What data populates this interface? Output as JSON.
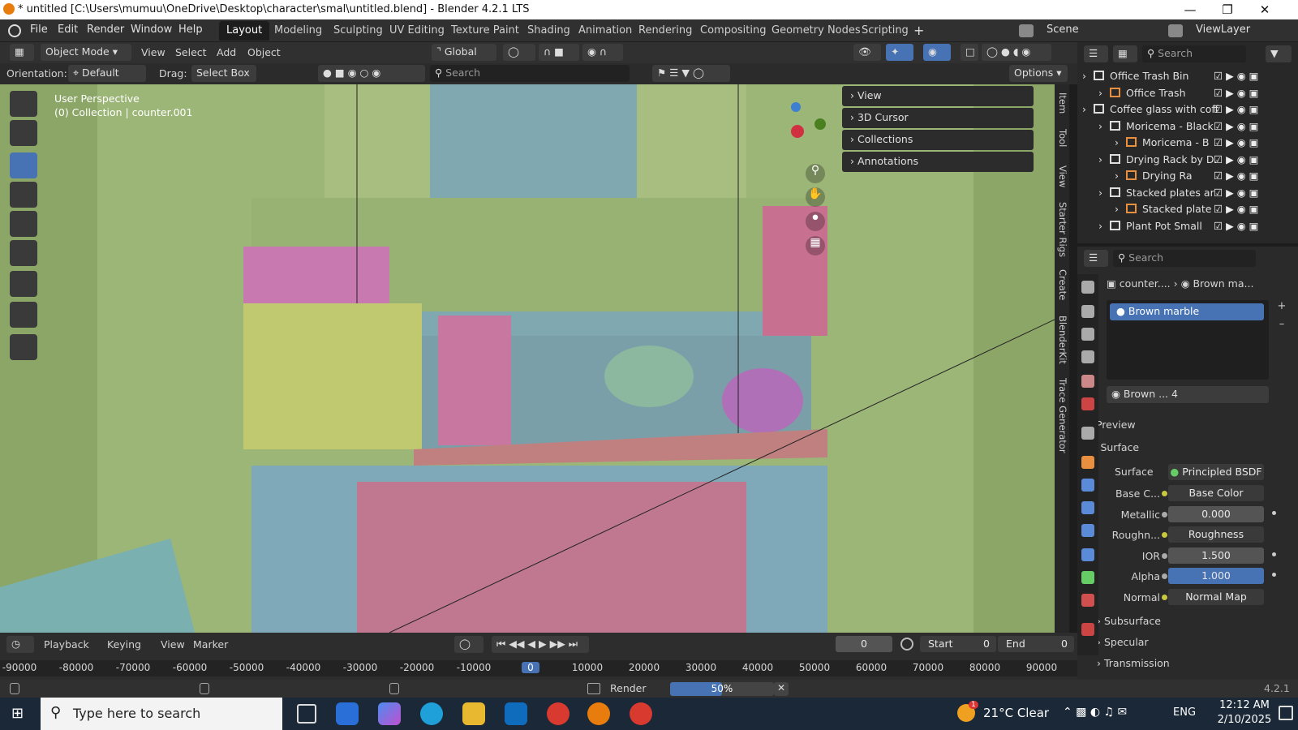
{
  "window": {
    "title": "* untitled [C:\\Users\\mumuu\\OneDrive\\Desktop\\character\\smal\\untitled.blend] - Blender 4.2.1 LTS"
  },
  "menus": [
    "File",
    "Edit",
    "Render",
    "Window",
    "Help"
  ],
  "workspaces": [
    "Layout",
    "Modeling",
    "Sculpting",
    "UV Editing",
    "Texture Paint",
    "Shading",
    "Animation",
    "Rendering",
    "Compositing",
    "Geometry Nodes",
    "Scripting"
  ],
  "scene": "Scene",
  "viewlayer": "ViewLayer",
  "header": {
    "mode": "Object Mode",
    "view": "View",
    "select": "Select",
    "add": "Add",
    "object": "Object",
    "transform": "Global"
  },
  "header3": {
    "orientation_label": "Orientation:",
    "orientation": "Default",
    "drag_label": "Drag:",
    "drag": "Select Box",
    "search": "Search",
    "options": "Options"
  },
  "viewport": {
    "line1": "User Perspective",
    "line2": "(0) Collection | counter.001",
    "bg": "#8ca668"
  },
  "npanel": [
    "View",
    "3D Cursor",
    "Collections",
    "Annotations"
  ],
  "sidetabs": [
    "Item",
    "Tool",
    "View",
    "Starter Rigs",
    "Create",
    "BlenderKit",
    "Trace Generator"
  ],
  "outliner": {
    "search": "Search",
    "rows": [
      {
        "name": "Office Trash Bin",
        "indent": 0,
        "type": "collection"
      },
      {
        "name": "Office Trash",
        "indent": 1,
        "type": "object"
      },
      {
        "name": "Coffee glass with coff",
        "indent": 0,
        "type": "collection"
      },
      {
        "name": "Moricema - Black",
        "indent": 1,
        "type": "collection"
      },
      {
        "name": "Moricema - B",
        "indent": 2,
        "type": "object"
      },
      {
        "name": "Drying Rack by D.",
        "indent": 1,
        "type": "collection"
      },
      {
        "name": "Drying Ra",
        "indent": 2,
        "type": "object"
      },
      {
        "name": "Stacked plates ar",
        "indent": 1,
        "type": "collection"
      },
      {
        "name": "Stacked plate",
        "indent": 2,
        "type": "object"
      },
      {
        "name": "Plant Pot Small",
        "indent": 1,
        "type": "collection"
      }
    ]
  },
  "properties": {
    "search": "Search",
    "breadcrumb_obj": "counter....",
    "breadcrumb_mat": "Brown ma...",
    "material_slot": "Brown marble",
    "material_name": "Brown ...",
    "users": "4",
    "sections": {
      "preview": "Preview",
      "surface": "Surface"
    },
    "surface_label": "Surface",
    "surface_value": "Principled BSDF",
    "rows": [
      {
        "label": "Base C...",
        "value": "Base Color",
        "kind": "link"
      },
      {
        "label": "Metallic",
        "value": "0.000",
        "kind": "num"
      },
      {
        "label": "Roughn...",
        "value": "Roughness",
        "kind": "link"
      },
      {
        "label": "IOR",
        "value": "1.500",
        "kind": "num"
      },
      {
        "label": "Alpha",
        "value": "1.000",
        "kind": "numsel"
      },
      {
        "label": "Normal",
        "value": "Normal Map",
        "kind": "link"
      }
    ],
    "subsections": [
      "Subsurface",
      "Specular",
      "Transmission"
    ]
  },
  "timeline": {
    "playback": "Playback",
    "keying": "Keying",
    "view": "View",
    "marker": "Marker",
    "frame": "0",
    "start_label": "Start",
    "start": "0",
    "end_label": "End",
    "end": "0",
    "ticks": [
      "-90000",
      "-80000",
      "-70000",
      "-60000",
      "-50000",
      "-40000",
      "-30000",
      "-20000",
      "-10000",
      "0",
      "10000",
      "20000",
      "30000",
      "40000",
      "50000",
      "60000",
      "70000",
      "80000",
      "90000"
    ]
  },
  "status": {
    "render": "Render",
    "progress": "50%",
    "progress_frac": 0.5,
    "version": "4.2.1"
  },
  "taskbar": {
    "search": "Type here to search",
    "weather": "21°C  Clear",
    "lang": "ENG",
    "time": "12:12 AM",
    "date": "2/10/2025",
    "badge": "1"
  }
}
